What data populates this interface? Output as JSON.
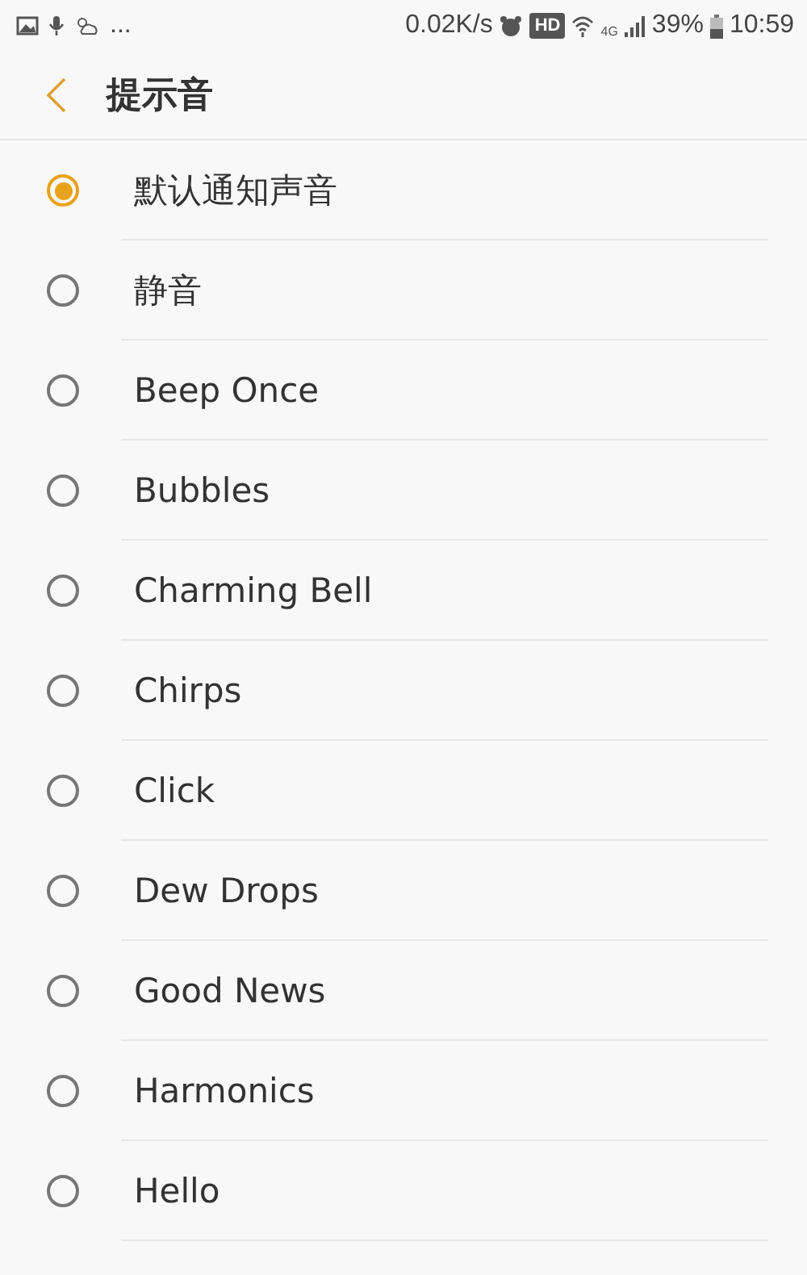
{
  "status_bar": {
    "overflow": "...",
    "speed": "0.02K/s",
    "hd": "HD",
    "network": "4G",
    "battery": "39%",
    "time": "10:59"
  },
  "header": {
    "title": "提示音"
  },
  "options": [
    {
      "label": "默认通知声音",
      "selected": true
    },
    {
      "label": "静音",
      "selected": false
    },
    {
      "label": "Beep Once",
      "selected": false
    },
    {
      "label": "Bubbles",
      "selected": false
    },
    {
      "label": "Charming Bell",
      "selected": false
    },
    {
      "label": "Chirps",
      "selected": false
    },
    {
      "label": "Click",
      "selected": false
    },
    {
      "label": "Dew Drops",
      "selected": false
    },
    {
      "label": "Good News",
      "selected": false
    },
    {
      "label": "Harmonics",
      "selected": false
    },
    {
      "label": "Hello",
      "selected": false
    }
  ]
}
